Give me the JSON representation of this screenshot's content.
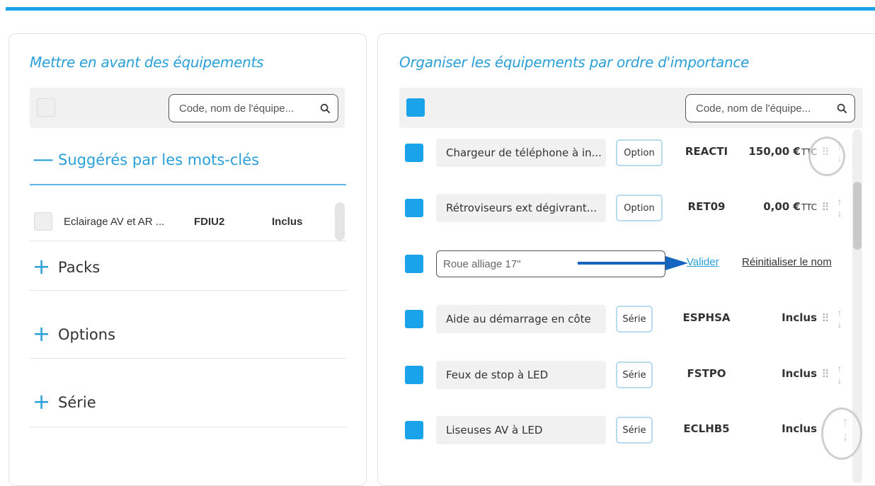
{
  "left_panel": {
    "title": "Mettre en avant des équipements",
    "search_placeholder": "Code, nom de l'équipe...",
    "sections": [
      {
        "sign": "—",
        "label": "Suggérés par les mots-clés"
      },
      {
        "sign": "+",
        "label": "Packs"
      },
      {
        "sign": "+",
        "label": "Options"
      },
      {
        "sign": "+",
        "label": "Série"
      }
    ],
    "suggested_item": {
      "name": "Eclairage AV et AR ...",
      "code": "FDIU2",
      "status": "Inclus"
    }
  },
  "right_panel": {
    "title": "Organiser les équipements par ordre d'importance",
    "search_placeholder": "Code, nom de l'équipe...",
    "rows": [
      {
        "name": "Chargeur de téléphone à in...",
        "type": "Option",
        "code": "REACTI",
        "price": "150,00 €",
        "price_suffix": "TTC"
      },
      {
        "name": "Rétroviseurs ext dégivrant...",
        "type": "Option",
        "code": "RET09",
        "price": "0,00 €",
        "price_suffix": "TTC"
      },
      {
        "name": "Aide au démarrage en côte",
        "type": "Série",
        "code": "ESPHSA",
        "price": "Inclus",
        "price_suffix": ""
      },
      {
        "name": "Feux de stop à LED",
        "type": "Série",
        "code": "FSTPO",
        "price": "Inclus",
        "price_suffix": ""
      },
      {
        "name": "Liseuses AV à LED",
        "type": "Série",
        "code": "ECLHB5",
        "price": "Inclus",
        "price_suffix": ""
      }
    ],
    "edit_row": {
      "input_value": "Roue alliage 17\"",
      "validate_label": "Valider",
      "reset_label": "Réinitialiser le nom"
    }
  },
  "colors": {
    "accent": "#1aa3e8",
    "title": "#2a9fd8"
  },
  "icons": {
    "search": "search-icon",
    "grip": "drag-handle-icon",
    "sort": "sort-arrows-icon"
  }
}
